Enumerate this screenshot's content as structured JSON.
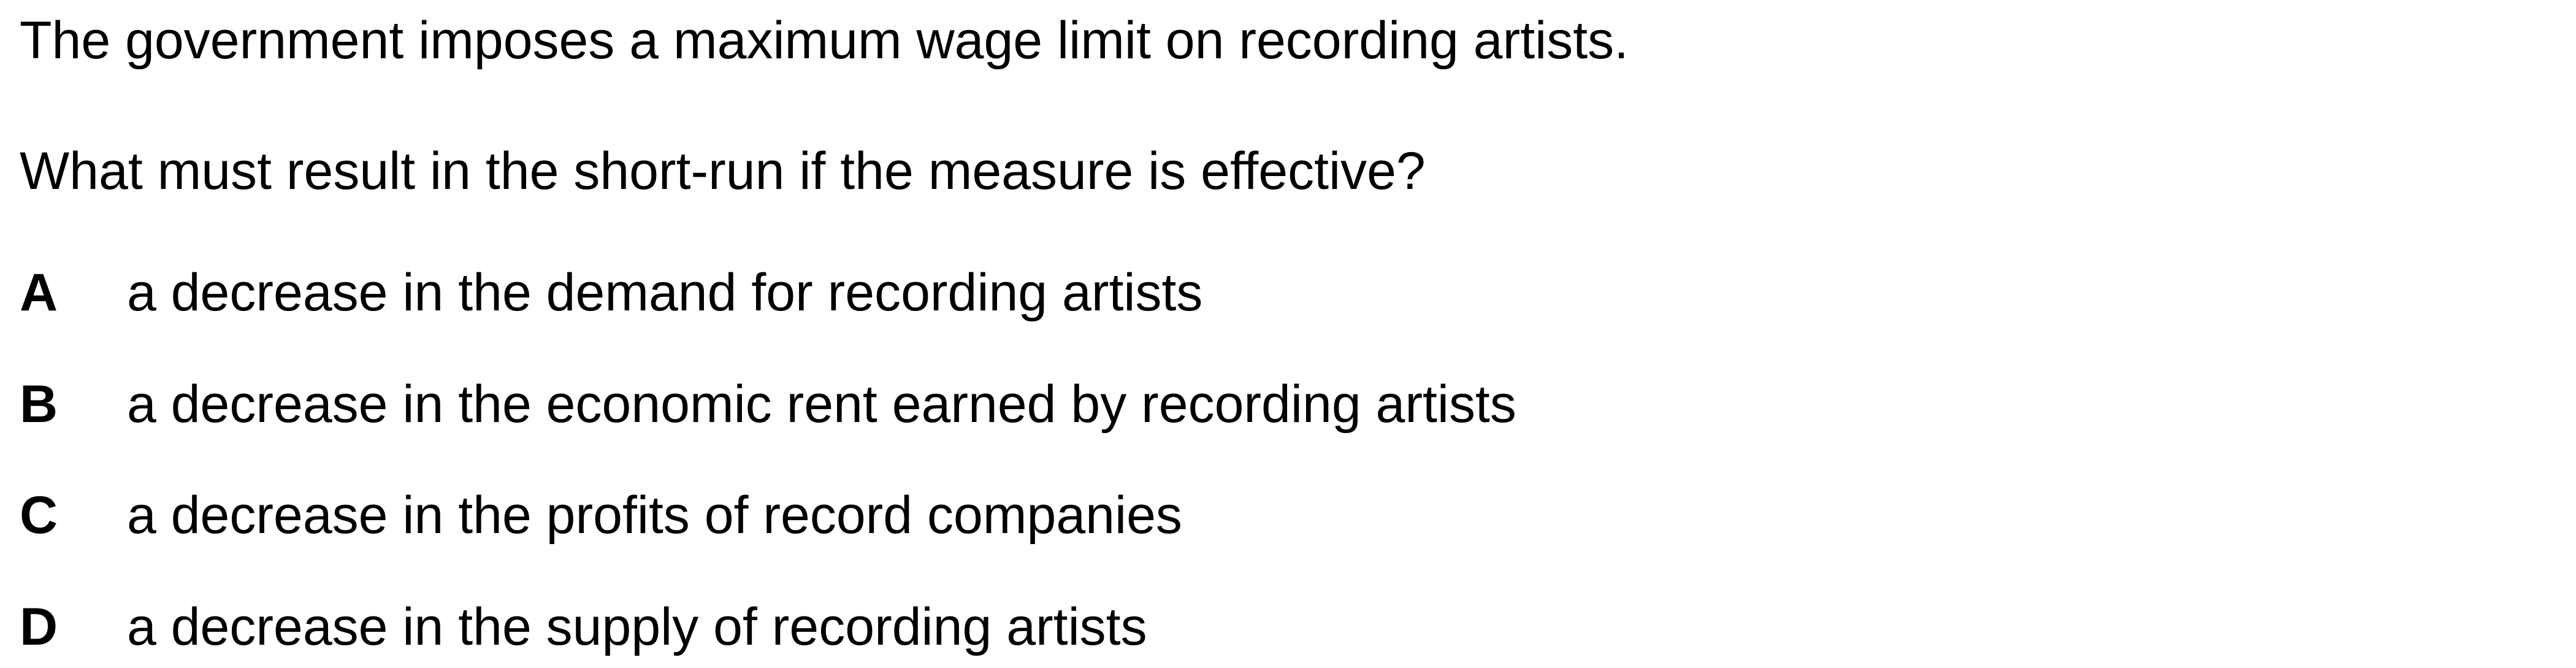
{
  "question": {
    "stem": [
      "The government imposes a maximum wage limit on recording artists.",
      "What must result in the short-run if the measure is effective?"
    ],
    "options": [
      {
        "letter": "A",
        "text": "a decrease in the demand for recording artists"
      },
      {
        "letter": "B",
        "text": "a decrease in the economic rent earned by recording artists"
      },
      {
        "letter": "C",
        "text": "a decrease in the profits of record companies"
      },
      {
        "letter": "D",
        "text": "a decrease in the supply of recording artists"
      }
    ]
  }
}
